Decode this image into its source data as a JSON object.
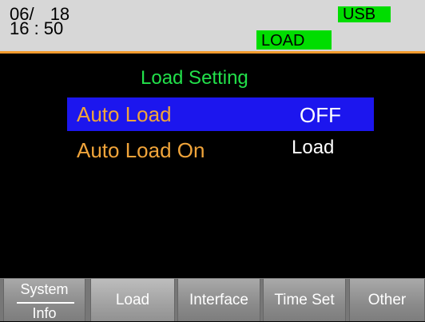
{
  "status": {
    "date": "06/ 18",
    "time": "16 : 50",
    "usb_badge": "USB",
    "load_badge": "LOAD"
  },
  "page": {
    "title": "Load Setting",
    "settings": [
      {
        "label": "Auto Load",
        "value": "OFF",
        "selected": true
      },
      {
        "label": "Auto Load On",
        "value": "Load",
        "selected": false
      }
    ]
  },
  "softkeys": {
    "system_line1": "System",
    "system_line2": "Info",
    "load": "Load",
    "interface": "Interface",
    "time_set": "Time Set",
    "other": "Other"
  },
  "colors": {
    "status_bg": "#d7d7d7",
    "accent_orange": "#f29b2e",
    "badge_green": "#00dd00",
    "title_green": "#22e04a",
    "selection_blue": "#1c16ee",
    "label_orange": "#f0a43a"
  }
}
